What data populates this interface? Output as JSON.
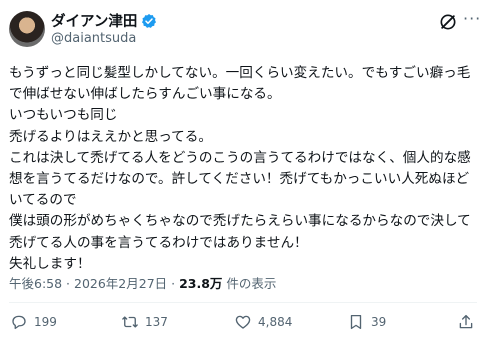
{
  "author": {
    "name": "ダイアン津田",
    "handle": "@daiantsuda"
  },
  "tweet": {
    "text": "もうずっと同じ髪型しかしてない。一回くらい変えたい。でもすごい癖っ毛で伸ばせない伸ばしたらすんごい事になる。\nいつもいつも同じ\n禿げるよりはええかと思ってる。\nこれは決して禿げてる人をどうのこうの言うてるわけではなく、個人的な感想を言うてるだけなので。許してください！禿げてもかっこいい人死ぬほどいてるので\n僕は頭の形がめちゃくちゃなので禿げたらえらい事になるからなので決して禿げてる人の事を言うてるわけではありません！\n失礼します！"
  },
  "meta": {
    "time": "午後6:58",
    "separator": " · ",
    "date": "2026年2月27日",
    "separator2": " · ",
    "views": "23.8万",
    "views_label": " 件の表示"
  },
  "actions": {
    "replies": "199",
    "reposts": "137",
    "likes": "4,884",
    "bookmarks": "39"
  },
  "colors": {
    "verified": "#1d9bf0",
    "text": "#0f1419",
    "muted": "#536471"
  },
  "icons": [
    "verified-badge-icon",
    "grok-icon",
    "more-icon",
    "reply-icon",
    "repost-icon",
    "like-icon",
    "bookmark-icon",
    "share-icon"
  ]
}
